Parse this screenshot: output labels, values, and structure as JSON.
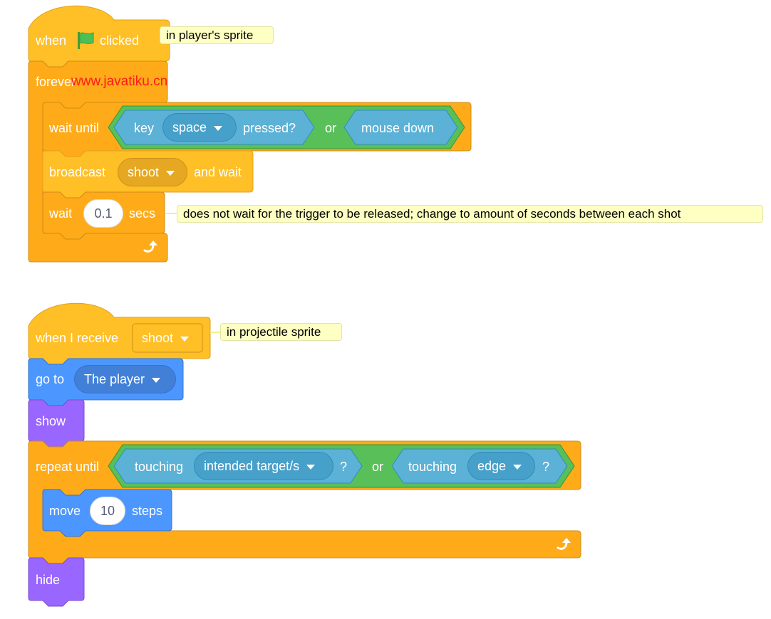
{
  "colors": {
    "events": "#ffbf26",
    "events_dark": "#e6a61c",
    "control": "#ffab19",
    "control_border": "#cf8b17",
    "sensing": "#5cb1d6",
    "sensing_dark": "#47a0ca",
    "operators": "#59c059",
    "motion": "#4c97ff",
    "motion_dark": "#3d7bd6",
    "looks": "#9966ff",
    "comment_bg": "#feffc2",
    "flag": "#4cbf56"
  },
  "watermark": "www.javatiku.cn",
  "script1": {
    "hat": {
      "when": "when",
      "flag_icon": "green-flag-icon",
      "clicked": "clicked"
    },
    "hat_comment": "in player's sprite",
    "forever": "forever",
    "wait_until": {
      "label": "wait until",
      "condition": {
        "left": {
          "key": "key",
          "key_value": "space",
          "pressed": "pressed?"
        },
        "op": "or",
        "right": "mouse down"
      }
    },
    "broadcast": {
      "label": "broadcast",
      "message": "shoot",
      "suffix": "and wait"
    },
    "wait": {
      "label": "wait",
      "value": "0.1",
      "unit": "secs"
    },
    "wait_comment": "does not wait for the trigger to be released; change to amount of seconds between each shot",
    "loop_icon": "loop-arrow-icon"
  },
  "script2": {
    "hat": {
      "label": "when I receive",
      "message": "shoot"
    },
    "hat_comment": "in projectile sprite",
    "goto": {
      "label": "go to",
      "target": "The player"
    },
    "show": "show",
    "repeat_until": {
      "label": "repeat until",
      "condition": {
        "left": {
          "touching": "touching",
          "target": "intended target/s",
          "q": "?"
        },
        "op": "or",
        "right": {
          "touching": "touching",
          "target": "edge",
          "q": "?"
        }
      }
    },
    "move": {
      "label": "move",
      "value": "10",
      "unit": "steps"
    },
    "hide": "hide",
    "loop_icon": "loop-arrow-icon"
  }
}
